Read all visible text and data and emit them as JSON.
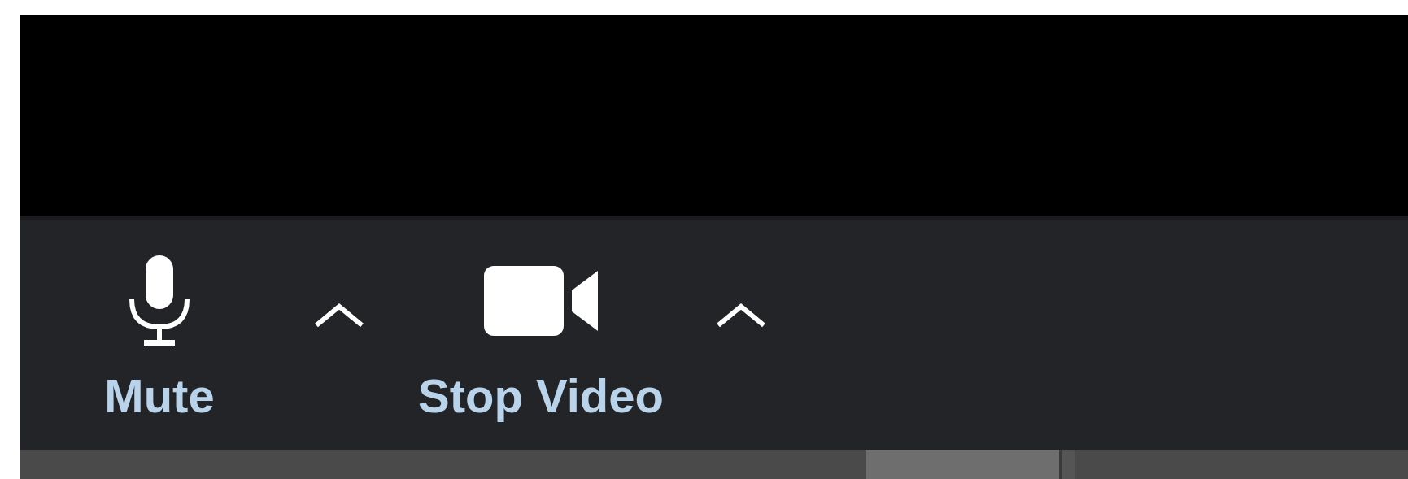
{
  "toolbar": {
    "buttons": [
      {
        "kind": "mute",
        "label": "Mute"
      },
      {
        "kind": "video",
        "label": "Stop Video"
      }
    ]
  }
}
